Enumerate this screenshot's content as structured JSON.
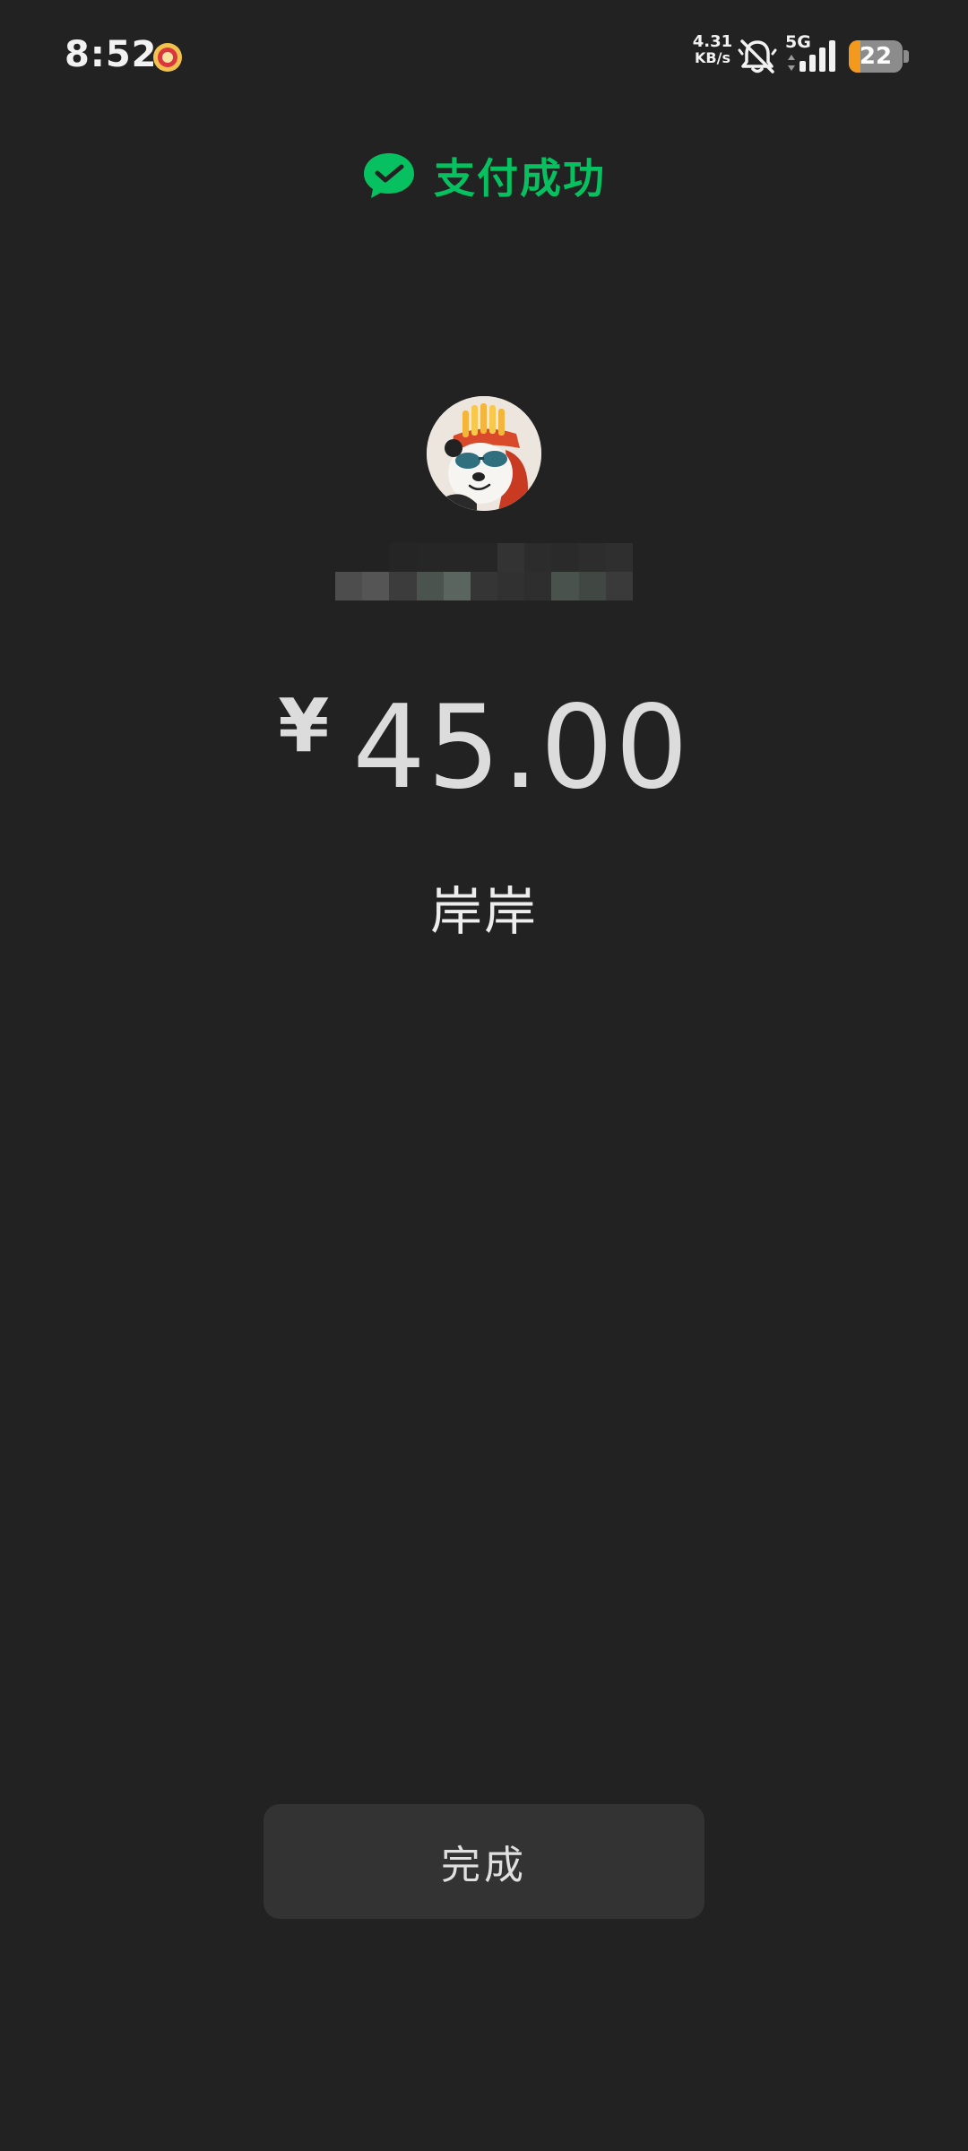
{
  "status_bar": {
    "time": "8:52",
    "net_speed_value": "4.31",
    "net_speed_unit": "KB/s",
    "network_type": "5G",
    "battery_level": "22",
    "battery_fraction": 0.22,
    "icons": [
      "app-notification-icon",
      "bell-muted-icon",
      "data-arrows-icon",
      "signal-icon",
      "battery-icon"
    ]
  },
  "header": {
    "icon": "wechat-pay-icon",
    "title": "支付成功",
    "accent_color": "#07c160"
  },
  "merchant": {
    "avatar": "panda-with-sunglasses-avatar"
  },
  "payment": {
    "currency_symbol": "¥",
    "amount": "45.00",
    "payee_name": "岸岸"
  },
  "actions": {
    "done_label": "完成"
  },
  "colors": {
    "background": "#222222",
    "button_bg": "#333333",
    "battery_fill": "#f39a1e"
  }
}
